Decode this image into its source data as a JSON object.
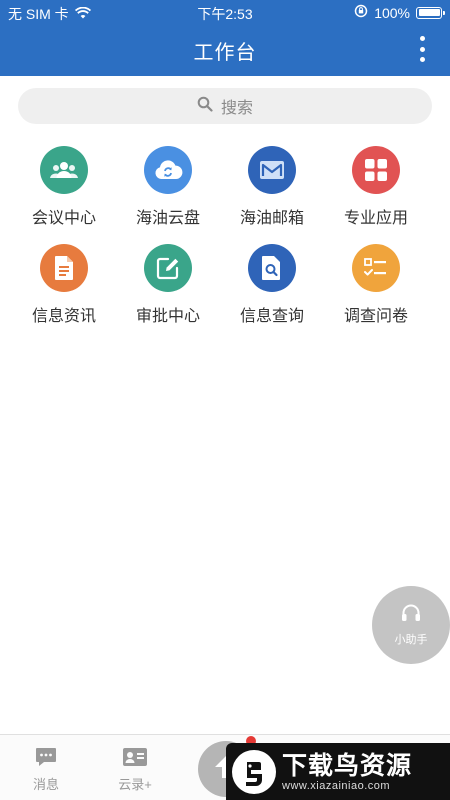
{
  "status_bar": {
    "carrier": "无 SIM 卡",
    "time": "下午2:53",
    "battery": "100%"
  },
  "header": {
    "title": "工作台"
  },
  "search": {
    "placeholder": "搜索"
  },
  "apps": [
    {
      "label": "会议中心",
      "icon": "people-icon",
      "color": "#3aa58a"
    },
    {
      "label": "海油云盘",
      "icon": "cloud-sync-icon",
      "color": "#4a90e2"
    },
    {
      "label": "海油邮箱",
      "icon": "mail-icon",
      "color": "#2f64b8"
    },
    {
      "label": "专业应用",
      "icon": "grid-apps-icon",
      "color": "#e15353"
    },
    {
      "label": "信息资讯",
      "icon": "document-icon",
      "color": "#e77b3e"
    },
    {
      "label": "审批中心",
      "icon": "edit-note-icon",
      "color": "#3aa58a"
    },
    {
      "label": "信息查询",
      "icon": "doc-search-icon",
      "color": "#2f64b8"
    },
    {
      "label": "调查问卷",
      "icon": "checklist-icon",
      "color": "#f0a43c"
    }
  ],
  "assistant": {
    "label": "小助手"
  },
  "tab_bar": {
    "items": [
      {
        "label": "消息"
      },
      {
        "label": "云录+"
      }
    ]
  },
  "watermark": {
    "title": "下载鸟资源",
    "url": "www.xiazainiao.com"
  }
}
